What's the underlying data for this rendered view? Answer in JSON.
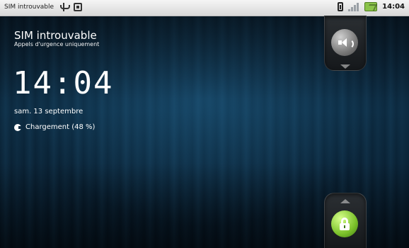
{
  "statusbar": {
    "carrier_short": "SIM introuvable",
    "time": "14:04"
  },
  "lockscreen": {
    "carrier": "SIM introuvable",
    "carrier_sub": "Appels d'urgence uniquement",
    "time": "14:04",
    "date": "sam. 13 septembre",
    "charging": "Chargement (48 %)"
  },
  "icons": {
    "usb": "usb-icon",
    "sd": "sd-card-icon",
    "battery": "battery-icon",
    "signal": "signal-icon",
    "battery_status": "battery-status-icon",
    "sound": "sound-icon",
    "lock": "unlock-icon"
  },
  "colors": {
    "unlock_accent": "#7bc12a"
  }
}
